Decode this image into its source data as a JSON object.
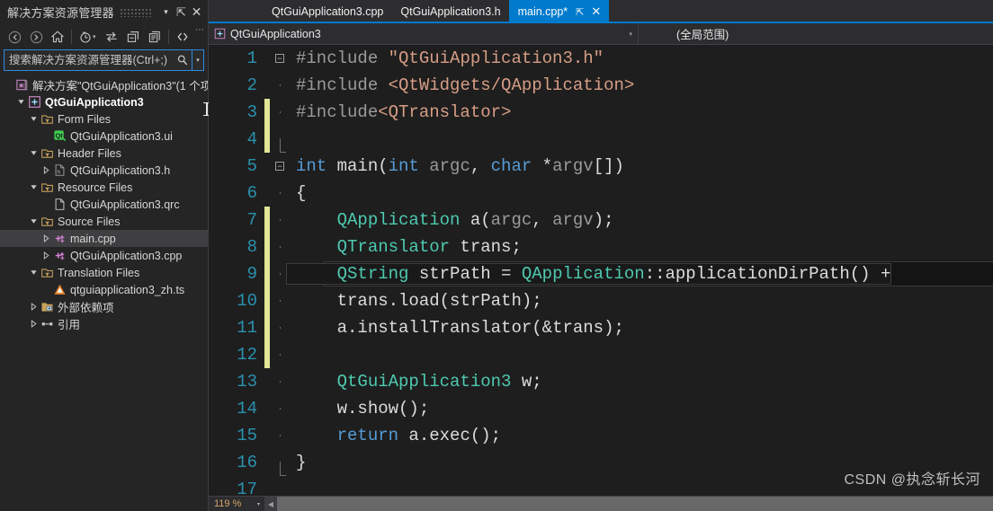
{
  "window": {
    "theme_bg": "#1e1e1e",
    "accent": "#007acc"
  },
  "solution_explorer": {
    "title": "解决方案资源管理器",
    "header_buttons": [
      {
        "name": "dropdown",
        "glyph": "▾"
      },
      {
        "name": "pin",
        "glyph": "⇱"
      },
      {
        "name": "close",
        "glyph": "✕"
      }
    ],
    "toolbar": [
      {
        "name": "back-icon",
        "title": "后退"
      },
      {
        "name": "forward-icon",
        "title": "前进"
      },
      {
        "name": "home-icon",
        "title": "主页"
      },
      {
        "name": "pending-changes-icon",
        "title": "挂起的更改筛选器"
      },
      {
        "name": "sync-with-active-document-icon",
        "title": "与活动文档同步"
      },
      {
        "name": "collapse-all-icon",
        "title": "全部折叠"
      },
      {
        "name": "properties-icon",
        "title": "属性"
      },
      {
        "name": "show-all-files-icon",
        "title": "显示所有文件"
      }
    ],
    "overflow_glyph": "⋯",
    "search": {
      "placeholder": "搜索解决方案资源管理器(Ctrl+;)",
      "value": "",
      "icon": "search-icon",
      "dropdown_glyph": "▾"
    },
    "tree": [
      {
        "id": "solution",
        "label": "解决方案\"QtGuiApplication3\"(1 个项",
        "depth": 0,
        "twisty": "none",
        "icon": "solution-icon",
        "bold": false,
        "selected": false
      },
      {
        "id": "project",
        "label": "QtGuiApplication3",
        "depth": 1,
        "twisty": "expanded",
        "icon": "project-icon",
        "bold": true,
        "selected": false
      },
      {
        "id": "form-files",
        "label": "Form Files",
        "depth": 2,
        "twisty": "expanded",
        "icon": "filter-icon",
        "bold": false,
        "selected": false
      },
      {
        "id": "ui-file",
        "label": "QtGuiApplication3.ui",
        "depth": 3,
        "twisty": "none",
        "icon": "qt-icon",
        "bold": false,
        "selected": false
      },
      {
        "id": "header-files",
        "label": "Header Files",
        "depth": 2,
        "twisty": "expanded",
        "icon": "filter-icon",
        "bold": false,
        "selected": false
      },
      {
        "id": "header-file",
        "label": "QtGuiApplication3.h",
        "depth": 3,
        "twisty": "collapsed",
        "icon": "h-file-icon",
        "bold": false,
        "selected": false
      },
      {
        "id": "resource-files",
        "label": "Resource Files",
        "depth": 2,
        "twisty": "expanded",
        "icon": "filter-icon",
        "bold": false,
        "selected": false
      },
      {
        "id": "qrc-file",
        "label": "QtGuiApplication3.qrc",
        "depth": 3,
        "twisty": "none",
        "icon": "blank-file-icon",
        "bold": false,
        "selected": false
      },
      {
        "id": "source-files",
        "label": "Source Files",
        "depth": 2,
        "twisty": "expanded",
        "icon": "filter-icon",
        "bold": false,
        "selected": false
      },
      {
        "id": "main-cpp",
        "label": "main.cpp",
        "depth": 3,
        "twisty": "collapsed",
        "icon": "cpp-file-icon",
        "bold": false,
        "selected": true
      },
      {
        "id": "app-cpp",
        "label": "QtGuiApplication3.cpp",
        "depth": 3,
        "twisty": "collapsed",
        "icon": "cpp-file-icon",
        "bold": false,
        "selected": false
      },
      {
        "id": "translation",
        "label": "Translation Files",
        "depth": 2,
        "twisty": "expanded",
        "icon": "filter-icon",
        "bold": false,
        "selected": false
      },
      {
        "id": "ts-file",
        "label": "qtguiapplication3_zh.ts",
        "depth": 3,
        "twisty": "none",
        "icon": "ts-file-icon",
        "bold": false,
        "selected": false
      },
      {
        "id": "external-deps",
        "label": "外部依赖项",
        "depth": 2,
        "twisty": "collapsed",
        "icon": "folder-deps-icon",
        "bold": false,
        "selected": false
      },
      {
        "id": "references",
        "label": "引用",
        "depth": 2,
        "twisty": "collapsed",
        "icon": "references-icon",
        "bold": false,
        "selected": false
      }
    ]
  },
  "editor": {
    "tabs": [
      {
        "label": "main.cpp*",
        "active": true,
        "pin_glyph": "⇱",
        "close_glyph": "✕"
      },
      {
        "label": "QtGuiApplication3.h",
        "active": false,
        "pin_glyph": "",
        "close_glyph": ""
      },
      {
        "label": "QtGuiApplication3.cpp",
        "active": false,
        "pin_glyph": "",
        "close_glyph": ""
      }
    ],
    "navbar": {
      "project": "QtGuiApplication3",
      "scope": "(全局范围)",
      "caret_glyph": "▾"
    },
    "zoom_level": "119 %",
    "zoom_caret_glyph": "▾",
    "scroll_left_glyph": "◀",
    "current_line": 9,
    "lines": [
      {
        "n": 1,
        "changed": false,
        "fold": "open-start",
        "tokens": [
          {
            "t": "#include ",
            "c": "t-pp"
          },
          {
            "t": "\"QtGuiApplication3.h\"",
            "c": "t-str"
          }
        ]
      },
      {
        "n": 2,
        "changed": false,
        "fold": "line",
        "tokens": [
          {
            "t": "#include ",
            "c": "t-pp"
          },
          {
            "t": "<QtWidgets/QApplication>",
            "c": "t-str"
          }
        ]
      },
      {
        "n": 3,
        "changed": true,
        "fold": "line",
        "tokens": [
          {
            "t": "#include",
            "c": "t-pp"
          },
          {
            "t": "<QTranslator>",
            "c": "t-str"
          }
        ]
      },
      {
        "n": 4,
        "changed": true,
        "fold": "end",
        "tokens": []
      },
      {
        "n": 5,
        "changed": false,
        "fold": "open-start",
        "tokens": [
          {
            "t": "int ",
            "c": "t-kw"
          },
          {
            "t": "main",
            "c": "t-plain"
          },
          {
            "t": "(",
            "c": "t-punc"
          },
          {
            "t": "int ",
            "c": "t-kw"
          },
          {
            "t": "argc",
            "c": "t-ident"
          },
          {
            "t": ", ",
            "c": "t-punc"
          },
          {
            "t": "char ",
            "c": "t-kw"
          },
          {
            "t": "*",
            "c": "t-punc"
          },
          {
            "t": "argv",
            "c": "t-ident"
          },
          {
            "t": "[])",
            "c": "t-punc"
          }
        ]
      },
      {
        "n": 6,
        "changed": false,
        "fold": "line",
        "tokens": [
          {
            "t": "{",
            "c": "t-punc"
          }
        ]
      },
      {
        "n": 7,
        "changed": true,
        "fold": "line",
        "tokens": [
          {
            "t": "    ",
            "c": "t-plain"
          },
          {
            "t": "QApplication",
            "c": "t-type"
          },
          {
            "t": " a",
            "c": "t-plain"
          },
          {
            "t": "(",
            "c": "t-punc"
          },
          {
            "t": "argc",
            "c": "t-ident"
          },
          {
            "t": ", ",
            "c": "t-punc"
          },
          {
            "t": "argv",
            "c": "t-ident"
          },
          {
            "t": ");",
            "c": "t-punc"
          }
        ]
      },
      {
        "n": 8,
        "changed": true,
        "fold": "line",
        "tokens": [
          {
            "t": "    ",
            "c": "t-plain"
          },
          {
            "t": "QTranslator",
            "c": "t-type"
          },
          {
            "t": " trans;",
            "c": "t-plain"
          }
        ]
      },
      {
        "n": 9,
        "changed": true,
        "fold": "line",
        "tokens": [
          {
            "t": "    ",
            "c": "t-plain"
          },
          {
            "t": "QString",
            "c": "t-type"
          },
          {
            "t": " strPath = ",
            "c": "t-plain"
          },
          {
            "t": "QApplication",
            "c": "t-type"
          },
          {
            "t": "::",
            "c": "t-punc"
          },
          {
            "t": "applicationDirPath",
            "c": "t-plain"
          },
          {
            "t": "() +",
            "c": "t-punc"
          }
        ]
      },
      {
        "n": 10,
        "changed": true,
        "fold": "line",
        "tokens": [
          {
            "t": "    trans.",
            "c": "t-plain"
          },
          {
            "t": "load",
            "c": "t-plain"
          },
          {
            "t": "(strPath);",
            "c": "t-plain"
          }
        ]
      },
      {
        "n": 11,
        "changed": true,
        "fold": "line",
        "tokens": [
          {
            "t": "    a.",
            "c": "t-plain"
          },
          {
            "t": "installTranslator",
            "c": "t-plain"
          },
          {
            "t": "(&trans);",
            "c": "t-plain"
          }
        ]
      },
      {
        "n": 12,
        "changed": true,
        "fold": "line",
        "tokens": []
      },
      {
        "n": 13,
        "changed": false,
        "fold": "line",
        "tokens": [
          {
            "t": "    ",
            "c": "t-plain"
          },
          {
            "t": "QtGuiApplication3",
            "c": "t-type"
          },
          {
            "t": " w;",
            "c": "t-plain"
          }
        ]
      },
      {
        "n": 14,
        "changed": false,
        "fold": "line",
        "tokens": [
          {
            "t": "    w.",
            "c": "t-plain"
          },
          {
            "t": "show",
            "c": "t-plain"
          },
          {
            "t": "();",
            "c": "t-plain"
          }
        ]
      },
      {
        "n": 15,
        "changed": false,
        "fold": "line",
        "tokens": [
          {
            "t": "    ",
            "c": "t-plain"
          },
          {
            "t": "return",
            "c": "t-kw"
          },
          {
            "t": " a.",
            "c": "t-plain"
          },
          {
            "t": "exec",
            "c": "t-plain"
          },
          {
            "t": "();",
            "c": "t-plain"
          }
        ]
      },
      {
        "n": 16,
        "changed": false,
        "fold": "end",
        "tokens": [
          {
            "t": "}",
            "c": "t-punc"
          }
        ]
      },
      {
        "n": 17,
        "changed": false,
        "fold": "none",
        "tokens": []
      }
    ]
  },
  "watermark": "CSDN @执念斩长河"
}
